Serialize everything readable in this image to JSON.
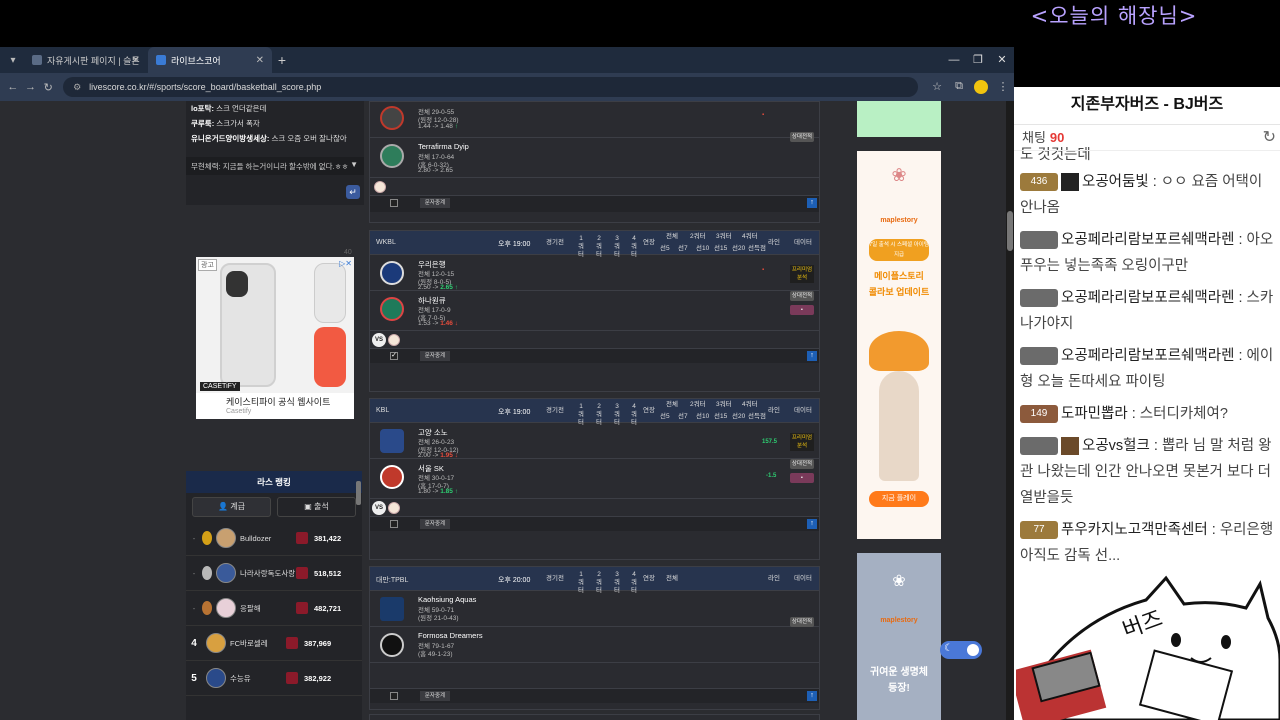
{
  "overlay_title": "<오늘의 해장님>",
  "browser": {
    "tabs": [
      {
        "label": "자유게시판 페이지 | 슬톤나리"
      },
      {
        "label": "라이브스코어"
      }
    ],
    "url": "livescore.co.kr/#/sports/score_board/basketball_score.php"
  },
  "chat": {
    "lines": [
      {
        "user": "lo포탁:",
        "text": "스크 언더같은데"
      },
      {
        "user": "쿠루룩:",
        "text": "스크가서 폭자"
      },
      {
        "user": "유니온거드양이방생세상:",
        "text": "스크 오즘 오버 잘나잖아"
      }
    ],
    "input_text": "무현체력: 지금들 하는거이니라 할수밖에 없다.ㅎㅎ"
  },
  "ad": {
    "tag": "광고",
    "title": "케이스티파이 공식 웹사이트",
    "brand": "Casetify",
    "chip": "CASETiFY",
    "side_num": "40"
  },
  "ranking": {
    "title": "라스 랭킹",
    "tabs": [
      "계급",
      "출석"
    ],
    "rows": [
      {
        "rank": "-",
        "name": "Bulldozer",
        "points": "381,422"
      },
      {
        "rank": "-",
        "name": "나라사랑독도사랑",
        "points": "518,512"
      },
      {
        "rank": "-",
        "name": "응팔해",
        "points": "482,721"
      },
      {
        "rank": "4",
        "name": "FC바로셀레",
        "points": "387,969"
      },
      {
        "rank": "5",
        "name": "수능유",
        "points": "382,922"
      }
    ]
  },
  "board": {
    "col_headers": {
      "status": "경기전",
      "q1": "1 쿼터",
      "q2": "2 쿼터",
      "q3": "3 쿼터",
      "q4": "4 쿼터",
      "ot": "연장",
      "total": "전체",
      "h1": "2쿼터",
      "h2": "3쿼터",
      "h3": "4쿼터",
      "sub1": "선5",
      "sub2": "선7",
      "sub3": "선10",
      "sub4": "선15",
      "sub5": "선20",
      "sub6": "선득점",
      "line": "라인",
      "data": "데이터"
    },
    "prev_game": {
      "team1": {
        "record": "전체 29-0-55",
        "sub": "(원정 12-0-28)",
        "odds": "1.44 -> 1.48"
      },
      "team2": {
        "name": "Terrafirma Dyip",
        "record": "전체 17-0-64",
        "sub": "(홈 6-0-32)",
        "odds": "2.80 -> 2.65"
      },
      "stat": "상대전적",
      "write": "문자중계"
    },
    "games": [
      {
        "league": "WKBL",
        "time": "오후 19:00",
        "team1": {
          "name": "우리은행",
          "record": "전체 12-0-15",
          "sub": "(원정 8-0-5)",
          "odds_from": "2.50 ->",
          "odds_to": "2.65"
        },
        "team2": {
          "name": "하나원큐",
          "record": "전체 17-0-9",
          "sub": "(홈 7-0-5)",
          "odds_from": "1.53 ->",
          "odds_to": "1.46"
        },
        "premium": "프리미엄 분석",
        "stat": "상대전적",
        "write": "문자중계"
      },
      {
        "league": "KBL",
        "time": "오후 19:00",
        "team1": {
          "name": "고양 소노",
          "record": "전체 26-0-23",
          "sub": "(원정 12-0-12)",
          "odds_from": "2.00 ->",
          "odds_to": "1.95"
        },
        "team2": {
          "name": "서울 SK",
          "record": "전체 30-0-17",
          "sub": "(홈 17-0-7)",
          "odds_from": "1.80 ->",
          "odds_to": "1.85"
        },
        "line_top": "157.5",
        "line_bottom": "-1.5",
        "premium": "프리미엄 분석",
        "stat": "상대전적",
        "write": "문자중계"
      },
      {
        "league": "대만:TPBL",
        "time": "오후 20:00",
        "team1": {
          "name": "Kaohsiung Aquas",
          "record": "전체 59-0-71",
          "sub": "(원정 21-0-43)"
        },
        "team2": {
          "name": "Formosa Dreamers",
          "record": "전체 79-1-67",
          "sub": "(홈 49-1-23)"
        },
        "stat": "상대전적",
        "write": "문자중계"
      }
    ]
  },
  "side_ads": {
    "maple_label": "maplestory",
    "maple_top": "7일 출석 시 스페셜 아이템 지급",
    "maple_line1": "메이플스토리",
    "maple_line2": "콜라보 업데이트",
    "maple_btn": "지금 플레이",
    "maple2_line1": "귀여운 생명체",
    "maple2_line2": "등장!"
  },
  "stream": {
    "title": "지존부자버즈 - BJ버즈",
    "chat_label": "채팅",
    "chat_count": "90",
    "messages": [
      {
        "lvl": "",
        "nick": "",
        "text": "도 것것는데"
      },
      {
        "lvl": "436",
        "nick": "오공어둠빛",
        "text": "ㅇㅇ 요즘 어택이 안나옴"
      },
      {
        "lvl": "",
        "nick": "오공페라리람보포르쉐맥라렌",
        "text": "아오 푸우는 넣는족족 오링이구만"
      },
      {
        "lvl": "",
        "nick": "오공페라리람보포르쉐맥라렌",
        "text": "스카나가야지"
      },
      {
        "lvl": "",
        "nick": "오공페라리람보포르쉐맥라렌",
        "text": "에이형 오늘 돈따세요 파이팅"
      },
      {
        "lvl": "149",
        "nick": "도파민뽑라",
        "text": "스터디카체여?"
      },
      {
        "lvl": "",
        "nick": "오공vs헐크",
        "text": "뽑라 님 말 처럼 왕관 나왔는데 인간 안나오면 못본거 보다 더 열받을듯"
      },
      {
        "lvl": "77",
        "nick": "푸우카지노고객만족센터",
        "text": "우리은행 아직도 감독 선..."
      }
    ],
    "cat_text": "버즈"
  }
}
